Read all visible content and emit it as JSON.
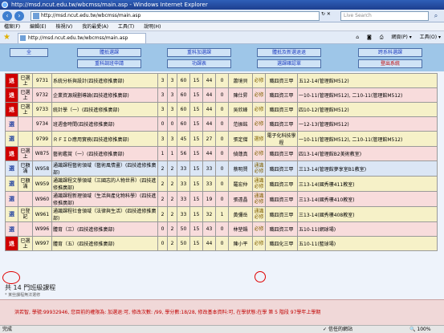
{
  "window": {
    "title": "http://msd.ncut.edu.tw/wbcmss/main.asp - Windows Internet Explorer",
    "url": "http://msd.ncut.edu.tw/wbcmss/main.asp",
    "search_placeholder": "Live Search",
    "tab_title": "http://msd.ncut.edu.tw/wbcmss/main.asp",
    "menu": [
      "檔案(F)",
      "編輯(E)",
      "檢視(V)",
      "我的最愛(A)",
      "工具(T)",
      "說明(H)"
    ],
    "commands": [
      "網頁(P) ▾",
      "工具(O) ▾"
    ]
  },
  "nav": {
    "row1": [
      "全",
      "體抵選課",
      "重科加選課",
      "體抵及新選退退",
      "跨系科選課"
    ],
    "row2": [
      "重科調班申請",
      "功課表",
      "選課確認單",
      "登出系統"
    ]
  },
  "courses": [
    {
      "act": "退",
      "status": "已選上",
      "code": "9731",
      "name": "系統分析與設計(四技進修推廣部)",
      "a": "3",
      "b": "3",
      "c": "60",
      "d": "15",
      "e": "44",
      "f": "0",
      "teacher": "蕭境貝",
      "req": "必修",
      "cls": "職四資三甲",
      "time": "五12-14(管理館M512)",
      "color": "y",
      "red": true
    },
    {
      "act": "退",
      "status": "已選上",
      "code": "9732",
      "name": "企業資源規劃導論(四技進修推廣部)",
      "a": "3",
      "b": "3",
      "c": "60",
      "d": "15",
      "e": "44",
      "f": "0",
      "teacher": "陳仕昇",
      "req": "必修",
      "cls": "職四資三甲",
      "time": "一10-11(管理館M512), 二10-11(管理館M512)",
      "color": "p",
      "red": true
    },
    {
      "act": "退",
      "status": "已選上",
      "code": "9733",
      "name": "統計學（一）(四技進修推廣部)",
      "a": "3",
      "b": "3",
      "c": "60",
      "d": "15",
      "e": "44",
      "f": "0",
      "teacher": "吳欣峰",
      "req": "必修",
      "cls": "職四資三甲",
      "time": "四10-12(管理館M512)",
      "color": "y",
      "red": true
    },
    {
      "act": "選",
      "status": "",
      "code": "9734",
      "name": "班週會時間(四技進修推廣部)",
      "a": "0",
      "b": "0",
      "c": "60",
      "d": "15",
      "e": "44",
      "f": "0",
      "teacher": "范振銘",
      "req": "必修",
      "cls": "職四資三甲",
      "time": "一12-13(管理館M512)",
      "color": "p",
      "red": false
    },
    {
      "act": "選",
      "status": "",
      "code": "9799",
      "name": "ＲＦＩＤ應用實務(四技進修推廣部)",
      "a": "3",
      "b": "3",
      "c": "45",
      "d": "15",
      "e": "27",
      "f": "0",
      "teacher": "張定傑",
      "req": "選修",
      "cls": "電子化科技學程",
      "time": "一10-11(管理館M512), 二10-11(管理館M512)",
      "color": "y",
      "red": false
    },
    {
      "act": "退",
      "status": "已選上",
      "code": "W875",
      "name": "藝術鑑賞（一）(四技進修推廣部)",
      "a": "1",
      "b": "1",
      "c": "56",
      "d": "15",
      "e": "44",
      "f": "0",
      "teacher": "偵蓮真",
      "req": "必修",
      "cls": "職四資三甲",
      "time": "四13-14(管理館B2美術教室)",
      "color": "p",
      "red": true
    },
    {
      "act": "選",
      "status": "已額滿",
      "code": "W958",
      "name": "通識課程藝術領域（藝術風情畫）(四技進修推廣部)",
      "a": "2",
      "b": "2",
      "c": "33",
      "d": "15",
      "e": "33",
      "f": "0",
      "teacher": "蔡明賢",
      "req": "通識必修",
      "cls": "職四資三甲",
      "time": "三13-14(管理館夢享室B1教室)",
      "color": "b",
      "red": false
    },
    {
      "act": "選",
      "status": "已額滿",
      "code": "W959",
      "name": "通識課程文學領域（三國志的人物世界）(四技進修推廣部)",
      "a": "2",
      "b": "2",
      "c": "33",
      "d": "15",
      "e": "33",
      "f": "0",
      "teacher": "羅宏仲",
      "req": "通識必修",
      "cls": "職四資三甲",
      "time": "三13-14(國秀樓411教室)",
      "color": "y",
      "red": false
    },
    {
      "act": "選",
      "status": "",
      "code": "W960",
      "name": "通識課程新理領域（生活與產化物科學）(四技進修推廣部)",
      "a": "2",
      "b": "2",
      "c": "33",
      "d": "15",
      "e": "19",
      "f": "0",
      "teacher": "張遠晶",
      "req": "通識必修",
      "cls": "職四資三甲",
      "time": "三13-14(國秀樓410教室)",
      "color": "p",
      "red": false
    },
    {
      "act": "選",
      "status": "已登記",
      "code": "W961",
      "name": "通識課程社會領域（法律與生活）(四技進修推廣部)",
      "a": "2",
      "b": "2",
      "c": "33",
      "d": "15",
      "e": "32",
      "f": "1",
      "teacher": "黃彌岳",
      "req": "通識必修",
      "cls": "職四資三甲",
      "time": "三13-14(國秀樓408教室)",
      "color": "y",
      "red": false
    },
    {
      "act": "選",
      "status": "",
      "code": "W996",
      "name": "體育（三）(四技進修推廣部)",
      "a": "0",
      "b": "2",
      "c": "50",
      "d": "15",
      "e": "43",
      "f": "0",
      "teacher": "林堃鍋",
      "req": "必修",
      "cls": "職四資三甲",
      "time": "五10-11(網球場)",
      "color": "p",
      "red": false
    },
    {
      "act": "退",
      "status": "已選上",
      "code": "W997",
      "name": "體育（五）(四技進修推廣部)",
      "a": "0",
      "b": "2",
      "c": "50",
      "d": "15",
      "e": "44",
      "f": "0",
      "teacher": "陳小平",
      "req": "必修",
      "cls": "職四化三甲",
      "time": "五10-11(籃球場)",
      "color": "y",
      "red": true
    }
  ],
  "summary": {
    "total": "共 14 門班級課程",
    "note": "* 某些課程無法選修"
  },
  "footer": "洪若智, 學號:99932946, 您目前的權限為: 加選退:可, 修改次數: /99, 學分數:18/28, 修改基本資料:可, 在學狀態:在學 第 5 階段 97學年上學期",
  "status": {
    "left": "完成",
    "zone": "信任的網站",
    "zoom": "100%"
  }
}
